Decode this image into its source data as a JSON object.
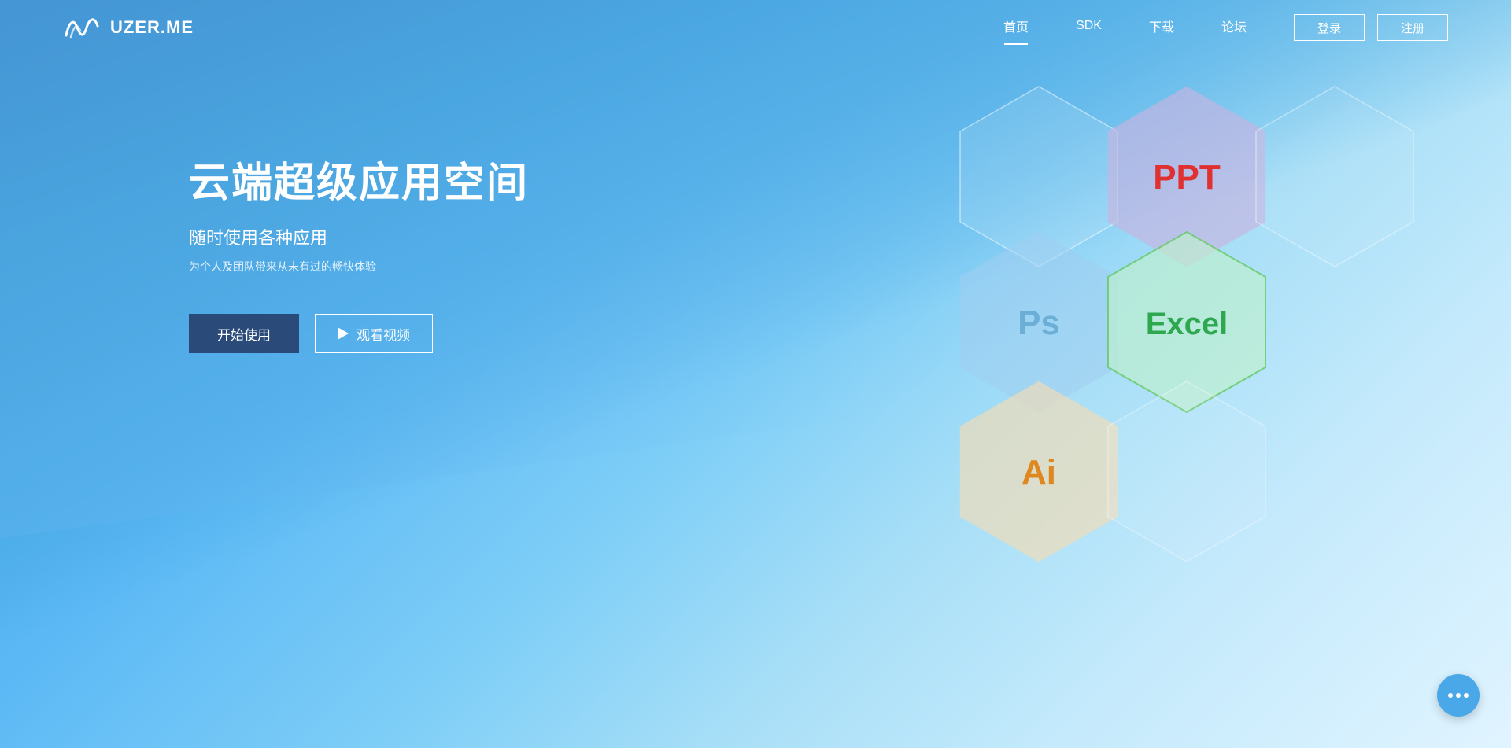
{
  "navbar": {
    "logo_text": "UZER.ME",
    "nav": [
      {
        "label": "首页",
        "active": true
      },
      {
        "label": "SDK",
        "active": false
      },
      {
        "label": "下载",
        "active": false
      },
      {
        "label": "论坛",
        "active": false
      }
    ],
    "btn_login": "登录",
    "btn_register": "注册"
  },
  "hero": {
    "title": "云端超级应用空间",
    "subtitle": "随时使用各种应用",
    "desc": "为个人及团队带来从未有过的畅快体验",
    "btn_start": "开始使用",
    "btn_video": "观看视频"
  },
  "hexagons": [
    {
      "id": "ppt",
      "label": "PPT",
      "color": "#e03030"
    },
    {
      "id": "ps",
      "label": "Ps",
      "color": "#6baed6"
    },
    {
      "id": "excel",
      "label": "Excel",
      "color": "#2ea84f"
    },
    {
      "id": "ai",
      "label": "Ai",
      "color": "#e08820"
    }
  ],
  "colors": {
    "accent": "#4aa8e8",
    "bg_start": "#2a7fc0",
    "bg_end": "#a8dff7"
  }
}
